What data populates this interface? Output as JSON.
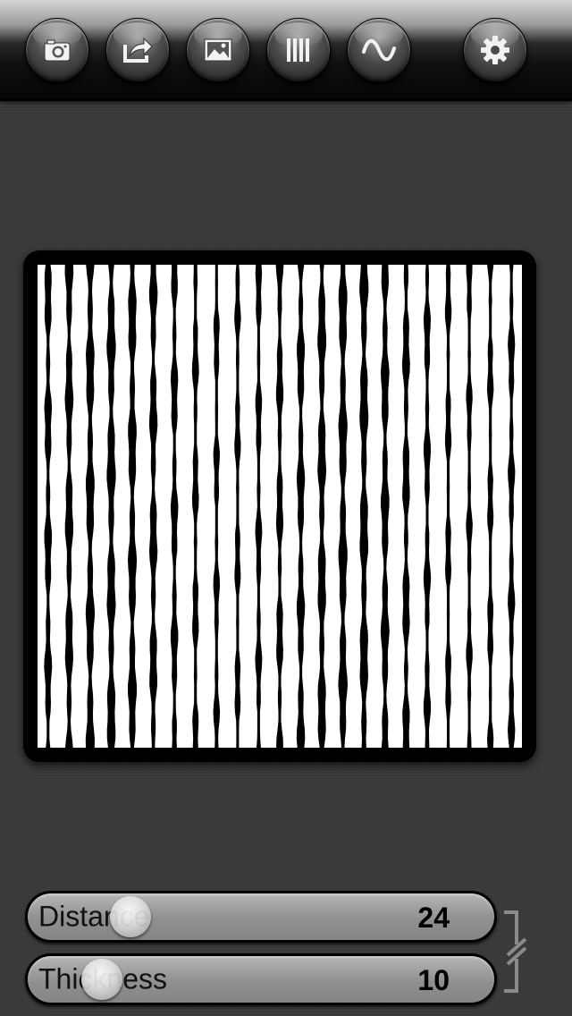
{
  "toolbar": {
    "buttons": [
      {
        "id": "camera",
        "icon": "camera-icon"
      },
      {
        "id": "share",
        "icon": "share-icon"
      },
      {
        "id": "photo",
        "icon": "image-icon"
      },
      {
        "id": "lines",
        "icon": "vertical-lines-icon"
      },
      {
        "id": "wave",
        "icon": "sine-wave-icon"
      },
      {
        "id": "settings",
        "icon": "gear-icon"
      }
    ]
  },
  "sliders": {
    "distance": {
      "label": "Distance",
      "value": "24",
      "level": 0.24
    },
    "thickness": {
      "label": "Thickness",
      "value": "10",
      "level": 0.1
    }
  },
  "link_icon": "link-bracket-icon",
  "colors": {
    "background": "#3a3a3a",
    "pattern_bg": "#ffffff",
    "pattern_lines": "#000000"
  }
}
